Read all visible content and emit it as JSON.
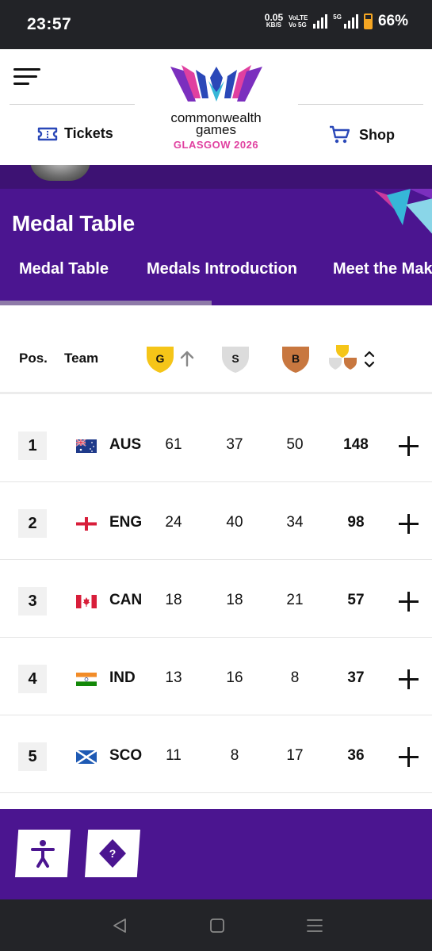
{
  "status_bar": {
    "time": "23:57",
    "speed_value": "0.05",
    "speed_unit": "KB/S",
    "volte_line1": "VoLTE",
    "volte_line2": "Vo 5G",
    "network": "5G",
    "battery": "66%"
  },
  "header": {
    "tickets_label": "Tickets",
    "shop_label": "Shop",
    "logo_line1": "commonwealth",
    "logo_line2": "games",
    "logo_line3": "GLASGOW 2026"
  },
  "page": {
    "title": "Medal Table",
    "tabs": [
      {
        "label": "Medal Table",
        "active": true
      },
      {
        "label": "Medals Introduction",
        "active": false
      },
      {
        "label": "Meet the Mak",
        "active": false
      }
    ]
  },
  "table": {
    "headers": {
      "pos": "Pos.",
      "team": "Team",
      "gold": "G",
      "silver": "S",
      "bronze": "B"
    },
    "rows": [
      {
        "pos": "1",
        "code": "AUS",
        "gold": "61",
        "silver": "37",
        "bronze": "50",
        "total": "148"
      },
      {
        "pos": "2",
        "code": "ENG",
        "gold": "24",
        "silver": "40",
        "bronze": "34",
        "total": "98"
      },
      {
        "pos": "3",
        "code": "CAN",
        "gold": "18",
        "silver": "18",
        "bronze": "21",
        "total": "57"
      },
      {
        "pos": "4",
        "code": "IND",
        "gold": "13",
        "silver": "16",
        "bronze": "8",
        "total": "37"
      },
      {
        "pos": "5",
        "code": "SCO",
        "gold": "11",
        "silver": "8",
        "bronze": "17",
        "total": "36"
      }
    ]
  },
  "colors": {
    "purple": "#4b1590",
    "purple_dark": "#3d1273",
    "gold": "#f5c518",
    "silver": "#dcdcdc",
    "bronze": "#c8773f",
    "brand_blue": "#2a48b8",
    "brand_pink": "#e040a0"
  },
  "icons": {
    "menu": "hamburger-menu-icon",
    "tickets": "ticket-icon",
    "shop": "shopping-cart-icon",
    "sort_gold": "arrow-up-icon",
    "sort_total": "sort-updown-icon",
    "expand": "plus-icon",
    "accessibility": "accessibility-icon",
    "help": "help-icon"
  }
}
